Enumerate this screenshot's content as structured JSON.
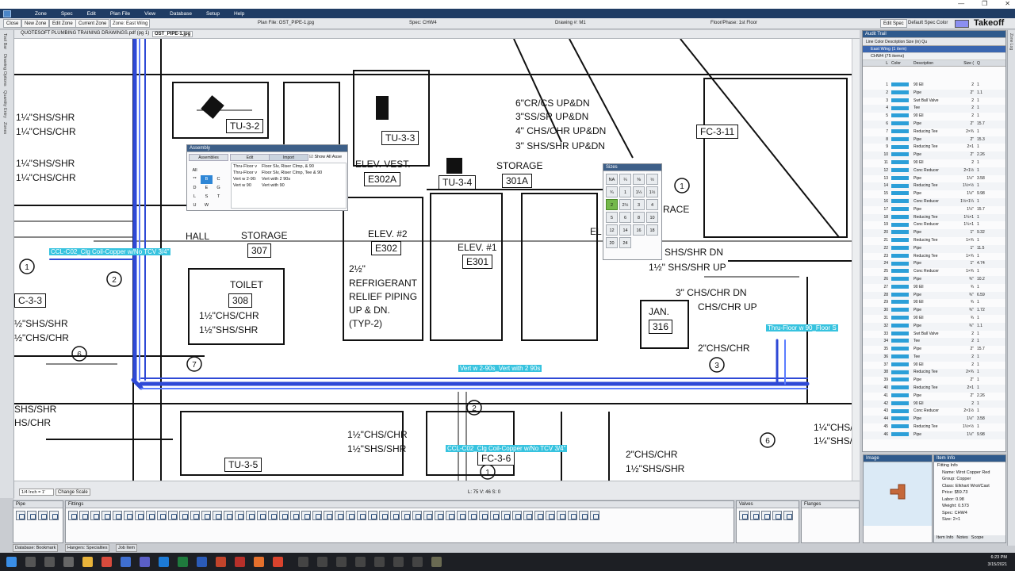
{
  "menu": [
    "Zone",
    "Spec",
    "Edit",
    "Plan File",
    "View",
    "Database",
    "Setup",
    "Help"
  ],
  "toolbar": {
    "buttons": [
      "Close",
      "New Zone",
      "Edit Zone",
      "Current Zone"
    ],
    "zone_label": "Zone: East Wing",
    "plan_file": "Plan File: OST_PIPE-1.jpg",
    "spec": "Spec: CHW4",
    "drawing": "Drawing #: M1",
    "floor_phase": "Floor/Phase: 1st Floor",
    "edit_spec": "Edit Spec",
    "default_spec_color": "Default Spec Color",
    "spec_color_hex": "#8b8ff0",
    "app_name": "Takeoff"
  },
  "left_strip": [
    "Tool Bar",
    "Drawing Options",
    "Quantity Entry",
    "Zones"
  ],
  "doc_tabs": [
    "QUOTESOFT PLUMBING TRAINING DRAWINGS.pdf (pg 1)",
    "OST_PIPE-1.jpg"
  ],
  "drawing": {
    "labels": [
      {
        "t": "1¼\"SHS/SHR"
      },
      {
        "t": "1¼\"CHS/CHR"
      },
      {
        "t": "1¼\"SHS/SHR"
      },
      {
        "t": "1¼\"CHS/CHR"
      },
      {
        "t": "TU-3-2",
        "box": true
      },
      {
        "t": "TU-3-3",
        "box": true
      },
      {
        "t": "6\"CR/CS UP&DN"
      },
      {
        "t": "3\"SS/SR UP&DN"
      },
      {
        "t": "4\" CHS/CHR UP&DN"
      },
      {
        "t": "3\" SHS/SHR UP&DN"
      },
      {
        "t": "FC-3-11",
        "box": true
      },
      {
        "t": "ELEV. VEST."
      },
      {
        "t": "E302A",
        "box": true
      },
      {
        "t": "STORAGE"
      },
      {
        "t": "301A",
        "box": true
      },
      {
        "t": "TU-3-4",
        "box": true
      },
      {
        "t": "HALL"
      },
      {
        "t": "STORAGE"
      },
      {
        "t": "307",
        "box": true
      },
      {
        "t": "ELEV. #2"
      },
      {
        "t": "E302",
        "box": true
      },
      {
        "t": "ELEV. #1"
      },
      {
        "t": "E301",
        "box": true
      },
      {
        "t": "EL"
      },
      {
        "t": "RACE"
      },
      {
        "t": "TOILET"
      },
      {
        "t": "308",
        "box": true
      },
      {
        "t": "2½\""
      },
      {
        "t": "REFRIGERANT"
      },
      {
        "t": "RELIEF PIPING"
      },
      {
        "t": "UP & DN."
      },
      {
        "t": "(TYP-2)"
      },
      {
        "t": "SHS/SHR DN"
      },
      {
        "t": "1½\" SHS/SHR UP"
      },
      {
        "t": "3\" CHS/CHR DN"
      },
      {
        "t": "CHS/CHR UP"
      },
      {
        "t": "JAN."
      },
      {
        "t": "316",
        "box": true
      },
      {
        "t": "1½\"CHS/CHR"
      },
      {
        "t": "1½\"SHS/SHR"
      },
      {
        "t": "½\"SHS/SHR"
      },
      {
        "t": "½\"CHS/CHR"
      },
      {
        "t": "C-3-3",
        "box": true
      },
      {
        "t": "2\"CHS/CHR"
      },
      {
        "t": "SHS/SHR"
      },
      {
        "t": "HS/CHR"
      },
      {
        "t": "1½\"CHS/CHR"
      },
      {
        "t": "1½\"SHS/SHR"
      },
      {
        "t": "TU-3-5",
        "box": true
      },
      {
        "t": "FC-3-6",
        "box": true
      },
      {
        "t": "2\"CHS/CHR"
      },
      {
        "t": "1½\"SHS/SHR"
      },
      {
        "t": "1¼\"CHS/C"
      },
      {
        "t": "1¼\"SHS/S"
      }
    ],
    "callouts": [
      "1",
      "2",
      "6",
      "7",
      "2",
      "3",
      "1",
      "6",
      "1"
    ],
    "highlights": [
      "CCL-C02_Clg Coil-Copper w/No TCV 3/4\"",
      "Vert w 2-90s_Vert with 2 90s",
      "Thru-Floor w 90_Floor S",
      "CCL-C02_Clg Coil-Copper w/No TCV 3/4\""
    ]
  },
  "assembly": {
    "title": "Assembly",
    "tabs": [
      "Assemblies",
      "Edit",
      "Import"
    ],
    "show_all": "Show All Asse",
    "letters": [
      "All",
      "",
      "",
      "**",
      "B",
      "C",
      "D",
      "E",
      "G",
      "L",
      "S",
      "T",
      "U",
      "W",
      ""
    ],
    "selected_letter": "B",
    "items": [
      {
        "code": "Thru-Floor v",
        "desc": "Floor Slv, Riser Clmp, & 90"
      },
      {
        "code": "Thru-Floor v",
        "desc": "Floor Slv, Riser Clmp, Tee & 90"
      },
      {
        "code": "Vert w 2-90:",
        "desc": "Vert with 2 90s"
      },
      {
        "code": "Vert w 90",
        "desc": "Vert with 90"
      }
    ]
  },
  "sizes": {
    "title": "Sizes",
    "values": [
      "NA",
      "¼",
      "⅜",
      "½",
      "¾",
      "1",
      "1¼",
      "1½",
      "2",
      "2½",
      "3",
      "4",
      "5",
      "6",
      "8",
      "10",
      "12",
      "14",
      "16",
      "18",
      "20",
      "24"
    ],
    "selected": "2"
  },
  "status": {
    "scale": "1/4 Inch = 1'",
    "change_scale": "Change Scale",
    "coords": "L: 75  V: 46  S: 0"
  },
  "panels": {
    "pipe": "Pipe",
    "fittings": "Fittings",
    "valves": "Valves",
    "flanges": "Flanges"
  },
  "bottom_tabs": [
    "Database: Bookmark",
    "Hangers: Specialties",
    "Job Item"
  ],
  "audit": {
    "title": "Audit Trail",
    "toolbar": "Line   Color     Description        Size (in)   Qu",
    "zone": "East Wing (1 item)",
    "spec": "CHW4 (75 items)",
    "head": [
      "L",
      "Color",
      "Description",
      "Size (",
      "Q"
    ],
    "rows": [
      {
        "n": "1",
        "d": "90 Ell",
        "s": "2",
        "q": "1"
      },
      {
        "n": "2",
        "d": "Pipe",
        "s": "2\"",
        "q": "1.1"
      },
      {
        "n": "3",
        "d": "Swt Ball Valve",
        "s": "2",
        "q": "1"
      },
      {
        "n": "4",
        "d": "Tee",
        "s": "2",
        "q": "1"
      },
      {
        "n": "5",
        "d": "90 Ell",
        "s": "2",
        "q": "1"
      },
      {
        "n": "6",
        "d": "Pipe",
        "s": "2\"",
        "q": "15.7"
      },
      {
        "n": "7",
        "d": "Reducing Tee",
        "s": "2×¾",
        "q": "1"
      },
      {
        "n": "8",
        "d": "Pipe",
        "s": "2\"",
        "q": "15.3"
      },
      {
        "n": "9",
        "d": "Reducing Tee",
        "s": "2×1",
        "q": "1"
      },
      {
        "n": "10",
        "d": "Pipe",
        "s": "2\"",
        "q": "2.26"
      },
      {
        "n": "11",
        "d": "90 Ell",
        "s": "2",
        "q": "1"
      },
      {
        "n": "12",
        "d": "Conc Reducer",
        "s": "2×1½",
        "q": "1"
      },
      {
        "n": "13",
        "d": "Pipe",
        "s": "1½\"",
        "q": "3.58"
      },
      {
        "n": "14",
        "d": "Reducing Tee",
        "s": "1½×½",
        "q": "1"
      },
      {
        "n": "15",
        "d": "Pipe",
        "s": "1½\"",
        "q": "9.98"
      },
      {
        "n": "16",
        "d": "Conc Reducer",
        "s": "1½×1¼",
        "q": "1"
      },
      {
        "n": "17",
        "d": "Pipe",
        "s": "1¼\"",
        "q": "15.7"
      },
      {
        "n": "18",
        "d": "Reducing Tee",
        "s": "1¼×1",
        "q": "1"
      },
      {
        "n": "19",
        "d": "Conc Reducer",
        "s": "1¼×1",
        "q": "1"
      },
      {
        "n": "20",
        "d": "Pipe",
        "s": "1\"",
        "q": "9.32"
      },
      {
        "n": "21",
        "d": "Reducing Tee",
        "s": "1×¾",
        "q": "1"
      },
      {
        "n": "22",
        "d": "Pipe",
        "s": "1\"",
        "q": "11.5"
      },
      {
        "n": "23",
        "d": "Reducing Tee",
        "s": "1×¾",
        "q": "1"
      },
      {
        "n": "24",
        "d": "Pipe",
        "s": "1\"",
        "q": "4.74"
      },
      {
        "n": "25",
        "d": "Conc Reducer",
        "s": "1×¾",
        "q": "1"
      },
      {
        "n": "26",
        "d": "Pipe",
        "s": "¾\"",
        "q": "10.2"
      },
      {
        "n": "27",
        "d": "90 Ell",
        "s": "¾",
        "q": "1"
      },
      {
        "n": "28",
        "d": "Pipe",
        "s": "¾\"",
        "q": "6.59"
      },
      {
        "n": "29",
        "d": "90 Ell",
        "s": "¾",
        "q": "1"
      },
      {
        "n": "30",
        "d": "Pipe",
        "s": "¾\"",
        "q": "1.72"
      },
      {
        "n": "31",
        "d": "90 Ell",
        "s": "¾",
        "q": "1"
      },
      {
        "n": "32",
        "d": "Pipe",
        "s": "¾\"",
        "q": "1.1"
      },
      {
        "n": "33",
        "d": "Swt Ball Valve",
        "s": "2",
        "q": "1"
      },
      {
        "n": "34",
        "d": "Tee",
        "s": "2",
        "q": "1"
      },
      {
        "n": "35",
        "d": "Pipe",
        "s": "2\"",
        "q": "15.7"
      },
      {
        "n": "36",
        "d": "Tee",
        "s": "2",
        "q": "1"
      },
      {
        "n": "37",
        "d": "90 Ell",
        "s": "2",
        "q": "1"
      },
      {
        "n": "38",
        "d": "Reducing Tee",
        "s": "2×¾",
        "q": "1"
      },
      {
        "n": "39",
        "d": "Pipe",
        "s": "2\"",
        "q": "1"
      },
      {
        "n": "40",
        "d": "Reducing Tee",
        "s": "2×1",
        "q": "1"
      },
      {
        "n": "41",
        "d": "Pipe",
        "s": "2\"",
        "q": "2.26"
      },
      {
        "n": "42",
        "d": "90 Ell",
        "s": "2",
        "q": "1"
      },
      {
        "n": "43",
        "d": "Conc Reducer",
        "s": "2×1½",
        "q": "1"
      },
      {
        "n": "44",
        "d": "Pipe",
        "s": "1½\"",
        "q": "3.58"
      },
      {
        "n": "45",
        "d": "Reducing Tee",
        "s": "1½×½",
        "q": "1"
      },
      {
        "n": "46",
        "d": "Pipe",
        "s": "1½\"",
        "q": "9.98"
      }
    ]
  },
  "image_panel": "Image",
  "item_info": {
    "title": "Item Info",
    "section": "Fitting Info",
    "rows": [
      "Name: Wrot Copper Red",
      "Group: Copper",
      "Class: Elkhart Wrot/Cast",
      "Price: $59.73",
      "Labor: 0.98",
      "Weight: 0.573",
      "Spec: CHW4",
      "Size: 2×1"
    ],
    "tabs": [
      "Item Info",
      "Notes",
      "Scope"
    ]
  },
  "right_strip": "Zone Log",
  "tray": {
    "time": "6:23 PM",
    "date": "3/15/2021"
  }
}
